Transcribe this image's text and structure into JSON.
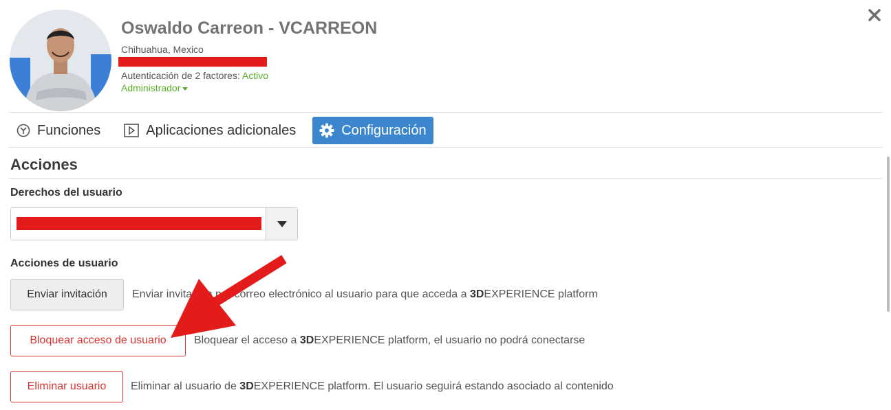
{
  "header": {
    "name": "Oswaldo Carreon - VCARREON",
    "location": "Chihuahua, Mexico",
    "twofa_label": "Autenticación de 2 factores: ",
    "twofa_status": "Activo",
    "role": "Administrador",
    "close_icon": "close-icon"
  },
  "tabs": [
    {
      "label": "Funciones",
      "icon": "roles-icon",
      "active": false
    },
    {
      "label": "Aplicaciones adicionales",
      "icon": "apps-play-icon",
      "active": false
    },
    {
      "label": "Configuración",
      "icon": "gear-icon",
      "active": true
    }
  ],
  "actions": {
    "title": "Acciones",
    "rights_label": "Derechos del usuario",
    "user_actions_label": "Acciones de usuario",
    "invite": {
      "label": "Enviar invitación",
      "desc_pre": "Enviar invitación por correo electrónico al usuario para que acceda a ",
      "brand_bold": "3D",
      "desc_post": "EXPERIENCE platform"
    },
    "block": {
      "label": "Bloquear acceso de usuario",
      "desc_pre": "Bloquear el acceso a ",
      "brand_bold": "3D",
      "desc_post": "EXPERIENCE platform, el usuario no podrá conectarse"
    },
    "delete": {
      "label": "Eliminar usuario",
      "desc_pre": "Eliminar al usuario de ",
      "brand_bold": "3D",
      "desc_post": "EXPERIENCE platform. El usuario seguirá estando asociado al contenido"
    }
  },
  "colors": {
    "accent_blue": "#3b86cc",
    "success_green": "#5aad2a",
    "danger_red": "#d93333",
    "annotation_red": "#e41b1b"
  }
}
